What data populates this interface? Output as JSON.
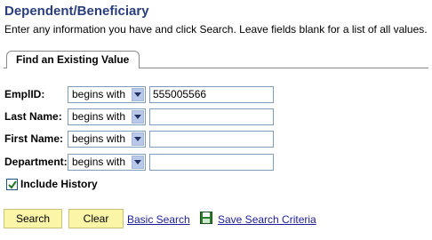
{
  "page": {
    "title": "Dependent/Beneficiary",
    "instructions": "Enter any information you have and click Search. Leave fields blank for a list of all values."
  },
  "tab": {
    "label": "Find an Existing Value"
  },
  "fields": [
    {
      "label": "EmplID:",
      "operator": "begins with",
      "value": "555005566"
    },
    {
      "label": "Last Name:",
      "operator": "begins with",
      "value": ""
    },
    {
      "label": "First Name:",
      "operator": "begins with",
      "value": ""
    },
    {
      "label": "Department:",
      "operator": "begins with",
      "value": ""
    }
  ],
  "include_history": {
    "label": "Include History",
    "checked": true
  },
  "actions": {
    "search": "Search",
    "clear": "Clear",
    "basic_search": "Basic Search",
    "save_search_criteria": "Save Search Criteria"
  },
  "colors": {
    "title": "#2a3d7c",
    "button_bg": "#fbf5a8",
    "link": "#1c1c9c",
    "input_border": "#7f9db9"
  },
  "icons": {
    "dropdown": "chevron-down-icon",
    "checkbox": "checkmark-icon",
    "save": "floppy-disk-icon"
  }
}
